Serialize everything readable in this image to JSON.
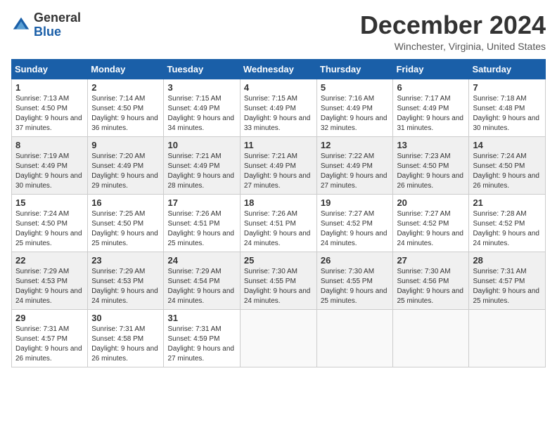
{
  "header": {
    "logo_general": "General",
    "logo_blue": "Blue",
    "month_title": "December 2024",
    "location": "Winchester, Virginia, United States"
  },
  "weekdays": [
    "Sunday",
    "Monday",
    "Tuesday",
    "Wednesday",
    "Thursday",
    "Friday",
    "Saturday"
  ],
  "weeks": [
    [
      {
        "day": "1",
        "sunrise": "7:13 AM",
        "sunset": "4:50 PM",
        "daylight": "9 hours and 37 minutes."
      },
      {
        "day": "2",
        "sunrise": "7:14 AM",
        "sunset": "4:50 PM",
        "daylight": "9 hours and 36 minutes."
      },
      {
        "day": "3",
        "sunrise": "7:15 AM",
        "sunset": "4:49 PM",
        "daylight": "9 hours and 34 minutes."
      },
      {
        "day": "4",
        "sunrise": "7:15 AM",
        "sunset": "4:49 PM",
        "daylight": "9 hours and 33 minutes."
      },
      {
        "day": "5",
        "sunrise": "7:16 AM",
        "sunset": "4:49 PM",
        "daylight": "9 hours and 32 minutes."
      },
      {
        "day": "6",
        "sunrise": "7:17 AM",
        "sunset": "4:49 PM",
        "daylight": "9 hours and 31 minutes."
      },
      {
        "day": "7",
        "sunrise": "7:18 AM",
        "sunset": "4:48 PM",
        "daylight": "9 hours and 30 minutes."
      }
    ],
    [
      {
        "day": "8",
        "sunrise": "7:19 AM",
        "sunset": "4:49 PM",
        "daylight": "9 hours and 30 minutes."
      },
      {
        "day": "9",
        "sunrise": "7:20 AM",
        "sunset": "4:49 PM",
        "daylight": "9 hours and 29 minutes."
      },
      {
        "day": "10",
        "sunrise": "7:21 AM",
        "sunset": "4:49 PM",
        "daylight": "9 hours and 28 minutes."
      },
      {
        "day": "11",
        "sunrise": "7:21 AM",
        "sunset": "4:49 PM",
        "daylight": "9 hours and 27 minutes."
      },
      {
        "day": "12",
        "sunrise": "7:22 AM",
        "sunset": "4:49 PM",
        "daylight": "9 hours and 27 minutes."
      },
      {
        "day": "13",
        "sunrise": "7:23 AM",
        "sunset": "4:50 PM",
        "daylight": "9 hours and 26 minutes."
      },
      {
        "day": "14",
        "sunrise": "7:24 AM",
        "sunset": "4:50 PM",
        "daylight": "9 hours and 26 minutes."
      }
    ],
    [
      {
        "day": "15",
        "sunrise": "7:24 AM",
        "sunset": "4:50 PM",
        "daylight": "9 hours and 25 minutes."
      },
      {
        "day": "16",
        "sunrise": "7:25 AM",
        "sunset": "4:50 PM",
        "daylight": "9 hours and 25 minutes."
      },
      {
        "day": "17",
        "sunrise": "7:26 AM",
        "sunset": "4:51 PM",
        "daylight": "9 hours and 25 minutes."
      },
      {
        "day": "18",
        "sunrise": "7:26 AM",
        "sunset": "4:51 PM",
        "daylight": "9 hours and 24 minutes."
      },
      {
        "day": "19",
        "sunrise": "7:27 AM",
        "sunset": "4:52 PM",
        "daylight": "9 hours and 24 minutes."
      },
      {
        "day": "20",
        "sunrise": "7:27 AM",
        "sunset": "4:52 PM",
        "daylight": "9 hours and 24 minutes."
      },
      {
        "day": "21",
        "sunrise": "7:28 AM",
        "sunset": "4:52 PM",
        "daylight": "9 hours and 24 minutes."
      }
    ],
    [
      {
        "day": "22",
        "sunrise": "7:29 AM",
        "sunset": "4:53 PM",
        "daylight": "9 hours and 24 minutes."
      },
      {
        "day": "23",
        "sunrise": "7:29 AM",
        "sunset": "4:53 PM",
        "daylight": "9 hours and 24 minutes."
      },
      {
        "day": "24",
        "sunrise": "7:29 AM",
        "sunset": "4:54 PM",
        "daylight": "9 hours and 24 minutes."
      },
      {
        "day": "25",
        "sunrise": "7:30 AM",
        "sunset": "4:55 PM",
        "daylight": "9 hours and 24 minutes."
      },
      {
        "day": "26",
        "sunrise": "7:30 AM",
        "sunset": "4:55 PM",
        "daylight": "9 hours and 25 minutes."
      },
      {
        "day": "27",
        "sunrise": "7:30 AM",
        "sunset": "4:56 PM",
        "daylight": "9 hours and 25 minutes."
      },
      {
        "day": "28",
        "sunrise": "7:31 AM",
        "sunset": "4:57 PM",
        "daylight": "9 hours and 25 minutes."
      }
    ],
    [
      {
        "day": "29",
        "sunrise": "7:31 AM",
        "sunset": "4:57 PM",
        "daylight": "9 hours and 26 minutes."
      },
      {
        "day": "30",
        "sunrise": "7:31 AM",
        "sunset": "4:58 PM",
        "daylight": "9 hours and 26 minutes."
      },
      {
        "day": "31",
        "sunrise": "7:31 AM",
        "sunset": "4:59 PM",
        "daylight": "9 hours and 27 minutes."
      },
      null,
      null,
      null,
      null
    ]
  ]
}
